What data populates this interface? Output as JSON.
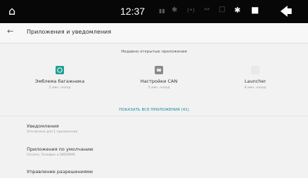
{
  "status_bar": {
    "time": "12:37"
  },
  "header": {
    "title": "Приложения и уведомления"
  },
  "recent": {
    "title": "Недавно открытые приложения",
    "apps": [
      {
        "name": "Эмблема багажника",
        "time": "5 мин. назад",
        "icon": "trunk-emblem-icon",
        "color": "#1f9e92"
      },
      {
        "name": "Настройки CAN",
        "time": "5 мин. назад",
        "icon": "can-settings-icon",
        "color": "#8a8a8a"
      },
      {
        "name": "Launcher",
        "time": "8 мин. назад",
        "icon": "launcher-icon",
        "color": "#e8e8e8"
      }
    ],
    "show_all": "ПОКАЗАТЬ ВСЕ ПРИЛОЖЕНИЯ (41)"
  },
  "settings": [
    {
      "title": "Уведомления",
      "subtitle": "Отключено для 1 приложения"
    },
    {
      "title": "Приложения по умолчанию",
      "subtitle": "Chrome, Телефон и SMS/MMS"
    },
    {
      "title": "Управление разрешениями",
      "subtitle": ""
    }
  ]
}
